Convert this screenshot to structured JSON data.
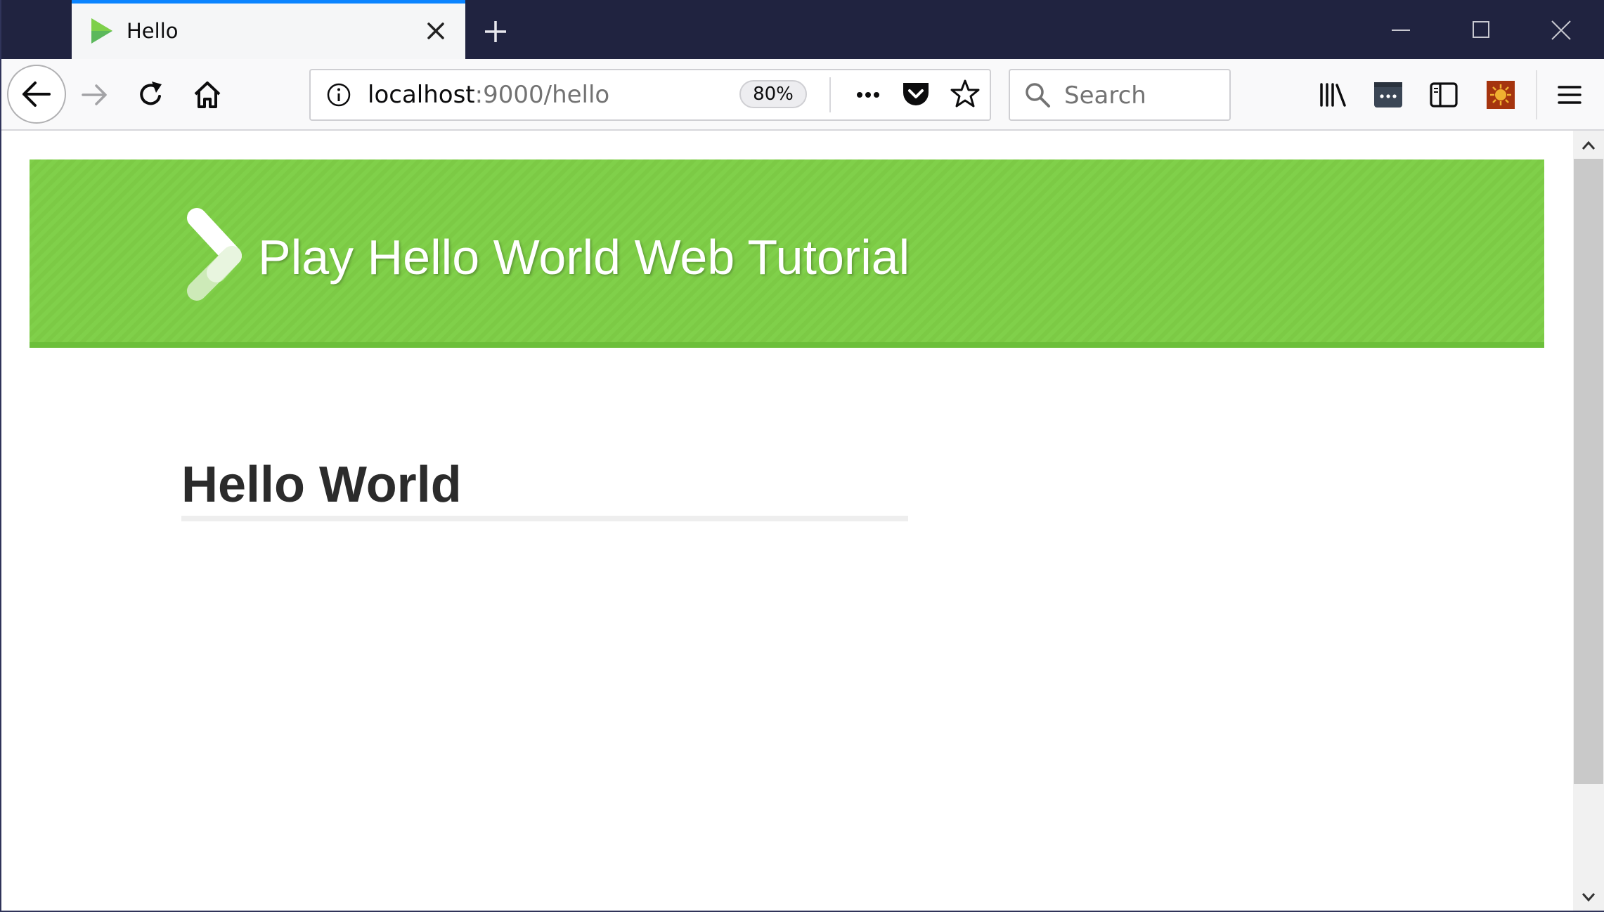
{
  "browser": {
    "tab": {
      "title": "Hello",
      "favicon": "play-favicon-icon"
    },
    "window_controls": [
      "minimize-icon",
      "maximize-icon",
      "close-window-icon"
    ],
    "url": {
      "host": "localhost",
      "rest": ":9000/hello"
    },
    "zoom": "80%",
    "search_placeholder": "Search",
    "toolbar_icons": [
      "library-icon",
      "password-manager-icon",
      "sidebar-icon",
      "extension-icon",
      "hamburger-menu-icon"
    ]
  },
  "page": {
    "site_title": "Play Hello World Web Tutorial",
    "heading": "Hello World"
  },
  "colors": {
    "header_green": "#80d04a",
    "titlebar": "#202340",
    "tab_accent": "#0a84ff"
  }
}
